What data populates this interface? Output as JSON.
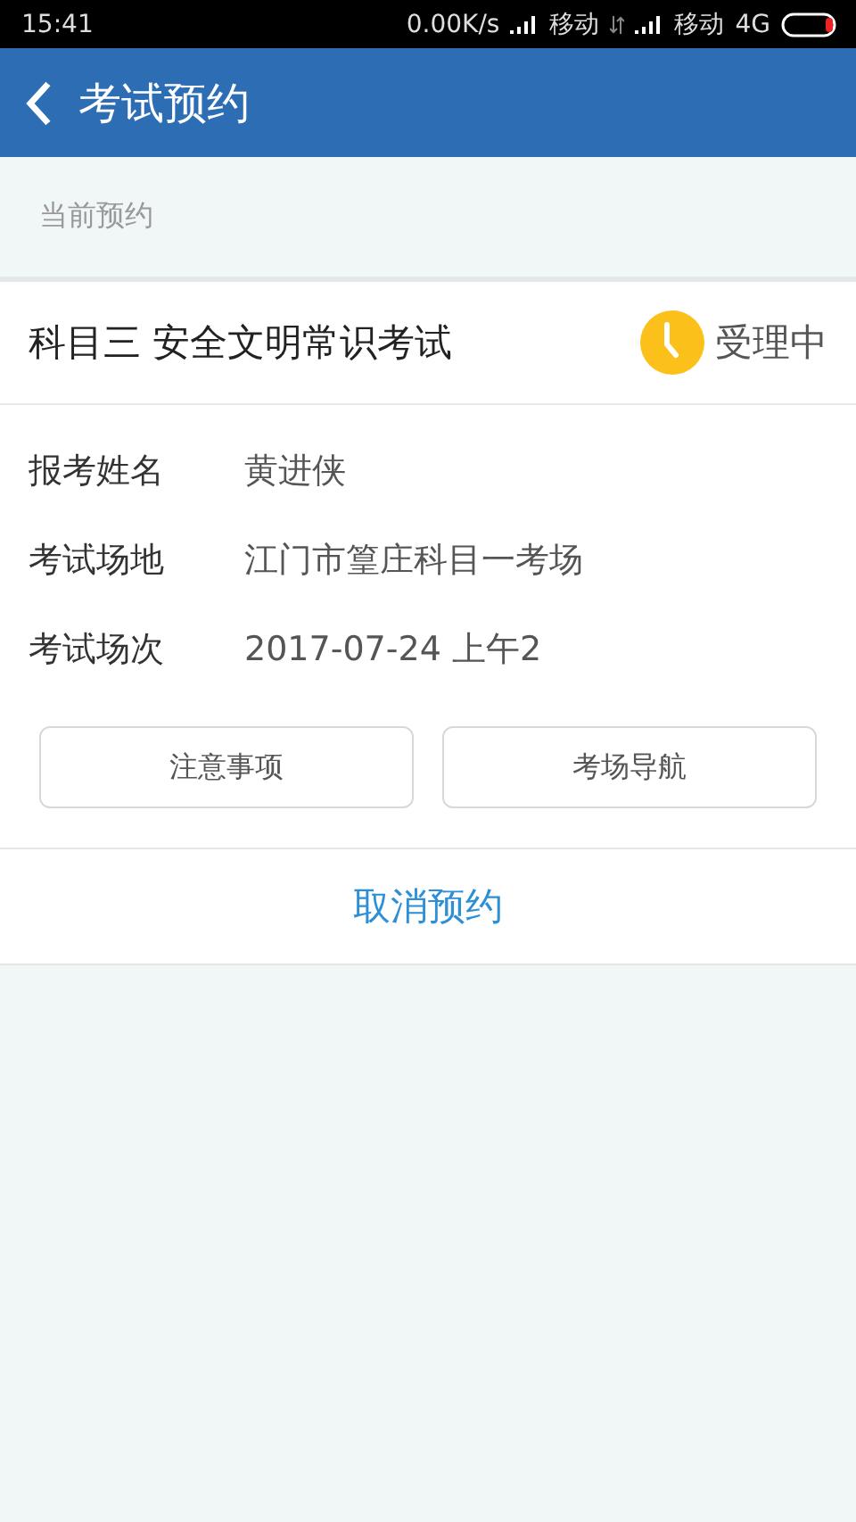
{
  "status_bar": {
    "time": "15:41",
    "speed": "0.00K/s",
    "carriers": [
      "移动",
      "移动"
    ],
    "network": "4G"
  },
  "header": {
    "title": "考试预约"
  },
  "section_label": "当前预约",
  "appointment": {
    "title": "科目三 安全文明常识考试",
    "status": "受理中",
    "fields": [
      {
        "label": "报考姓名",
        "value": "黄进侠"
      },
      {
        "label": "考试场地",
        "value": "江门市篁庄科目一考场"
      },
      {
        "label": "考试场次",
        "value": "2017-07-24  上午2"
      }
    ],
    "buttons": [
      "注意事项",
      "考场导航"
    ],
    "cancel": "取消预约"
  }
}
